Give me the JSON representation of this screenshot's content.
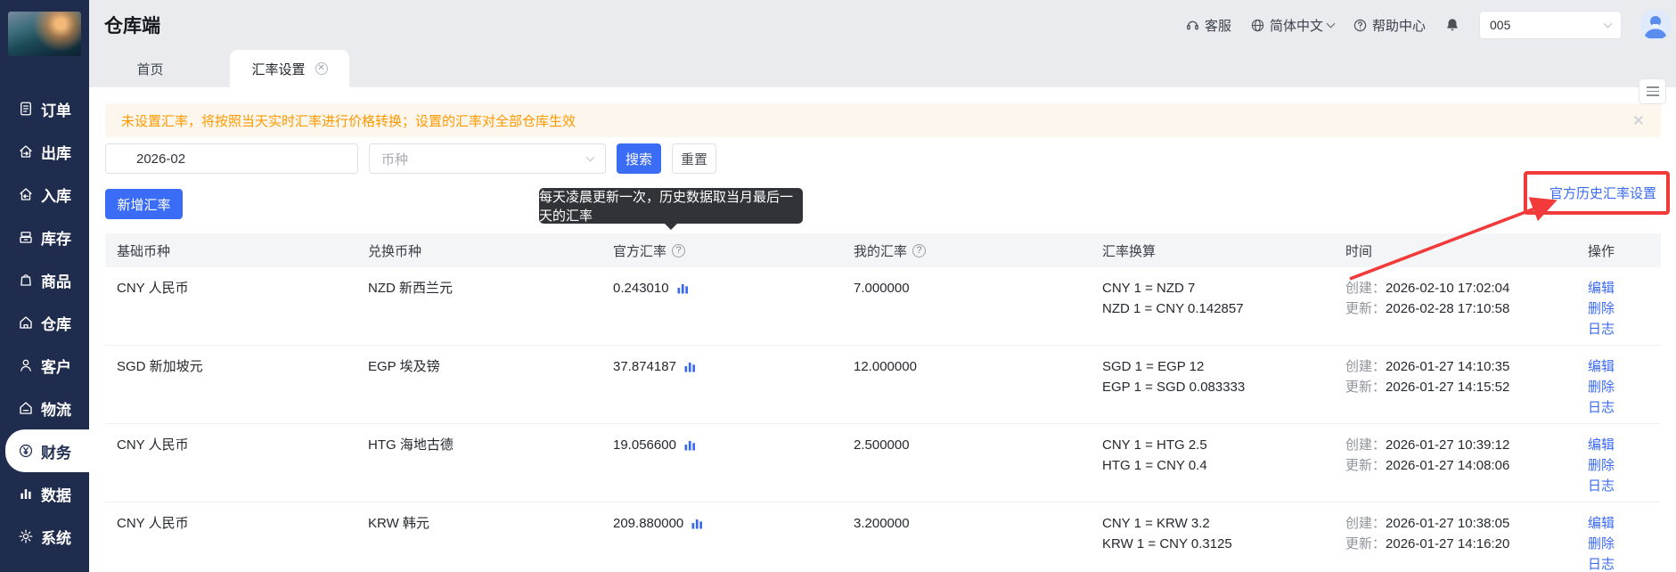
{
  "app_title": "仓库端",
  "colors": {
    "primary": "#3b6cf5",
    "link": "#3a6af5",
    "sidebar_bg": "#202c4e",
    "warning_text": "#ff9900",
    "warning_bg": "#fdf6ec",
    "annotation_red": "#f23a3a",
    "tooltip_bg": "#313339"
  },
  "sidebar": {
    "items": [
      {
        "key": "orders",
        "icon": "document-icon",
        "label": "订单",
        "active": false
      },
      {
        "key": "outbound",
        "icon": "outbound-icon",
        "label": "出库",
        "active": false
      },
      {
        "key": "inbound",
        "icon": "inbound-icon",
        "label": "入库",
        "active": false
      },
      {
        "key": "inventory",
        "icon": "inventory-icon",
        "label": "库存",
        "active": false
      },
      {
        "key": "products",
        "icon": "product-icon",
        "label": "商品",
        "active": false
      },
      {
        "key": "warehouse",
        "icon": "warehouse-icon",
        "label": "仓库",
        "active": false
      },
      {
        "key": "customers",
        "icon": "customer-icon",
        "label": "客户",
        "active": false
      },
      {
        "key": "logistics",
        "icon": "logistics-icon",
        "label": "物流",
        "active": false
      },
      {
        "key": "finance",
        "icon": "finance-icon",
        "label": "财务",
        "active": true
      },
      {
        "key": "data",
        "icon": "data-icon",
        "label": "数据",
        "active": false
      },
      {
        "key": "system",
        "icon": "system-icon",
        "label": "系统",
        "active": false
      }
    ]
  },
  "header": {
    "service_label": "客服",
    "language_label": "简体中文",
    "help_label": "帮助中心",
    "account_value": "005"
  },
  "tabs": {
    "home": "首页",
    "active_tab": "汇率设置",
    "close_glyph": "✕"
  },
  "banner": {
    "text": "未设置汇率，将按照当天实时汇率进行价格转换；设置的汇率对全部仓库生效",
    "close_glyph": "✕"
  },
  "filters": {
    "month_value": "2026-02",
    "currency_placeholder": "币种",
    "search_label": "搜索",
    "reset_label": "重置"
  },
  "toolbar": {
    "add_label": "新增汇率",
    "official_link_label": "官方历史汇率设置"
  },
  "tooltip": {
    "text": "每天凌晨更新一次，历史数据取当月最后一天的汇率"
  },
  "table": {
    "headers": {
      "base": "基础币种",
      "quote": "兑换币种",
      "official": "官方汇率",
      "mine": "我的汇率",
      "conversion": "汇率换算",
      "time": "时间",
      "actions": "操作"
    },
    "help_glyph": "?",
    "created_label": "创建：",
    "updated_label": "更新：",
    "action_labels": {
      "edit": "编辑",
      "delete": "删除",
      "log": "日志"
    },
    "rows": [
      {
        "base": "CNY 人民币",
        "quote": "NZD 新西兰元",
        "official": "0.243010",
        "mine": "7.000000",
        "conv1": "CNY 1 = NZD 7",
        "conv2": "NZD 1 = CNY 0.142857",
        "created": "2026-02-10 17:02:04",
        "updated": "2026-02-28 17:10:58"
      },
      {
        "base": "SGD 新加坡元",
        "quote": "EGP 埃及镑",
        "official": "37.874187",
        "mine": "12.000000",
        "conv1": "SGD 1 = EGP 12",
        "conv2": "EGP 1 = SGD 0.083333",
        "created": "2026-01-27 14:10:35",
        "updated": "2026-01-27 14:15:52"
      },
      {
        "base": "CNY 人民币",
        "quote": "HTG 海地古德",
        "official": "19.056600",
        "mine": "2.500000",
        "conv1": "CNY 1 = HTG 2.5",
        "conv2": "HTG 1 = CNY 0.4",
        "created": "2026-01-27 10:39:12",
        "updated": "2026-01-27 14:08:06"
      },
      {
        "base": "CNY 人民币",
        "quote": "KRW 韩元",
        "official": "209.880000",
        "mine": "3.200000",
        "conv1": "CNY 1 = KRW 3.2",
        "conv2": "KRW 1 = CNY 0.3125",
        "created": "2026-01-27 10:38:05",
        "updated": "2026-01-27 14:16:20"
      }
    ]
  }
}
